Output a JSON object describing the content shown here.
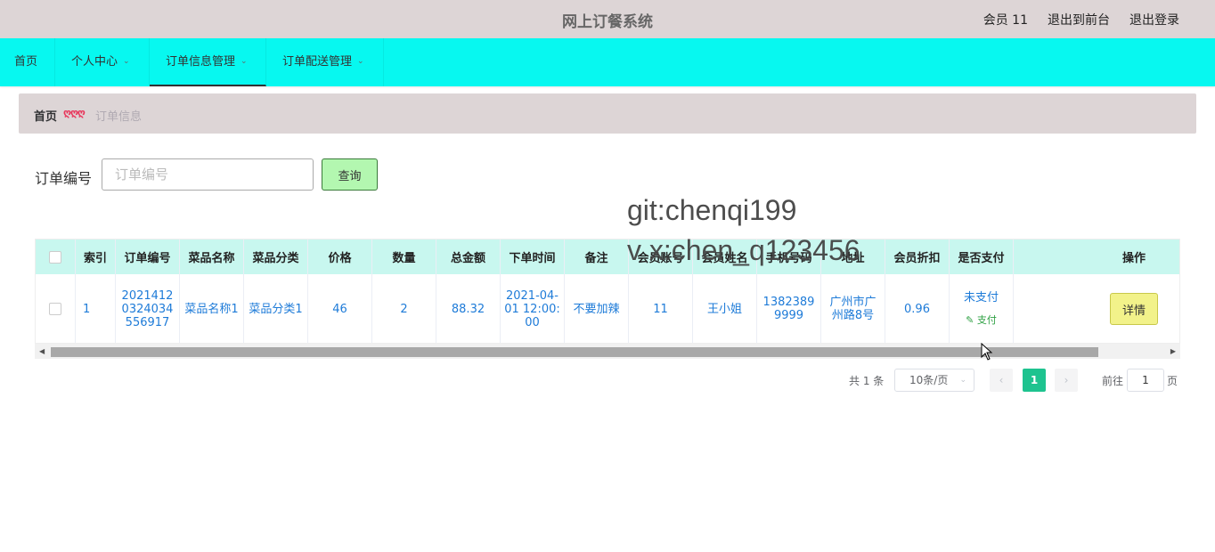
{
  "header": {
    "title": "网上订餐系统",
    "member": "会员 11",
    "exit_front": "退出到前台",
    "logout": "退出登录"
  },
  "nav": {
    "items": [
      {
        "label": "首页",
        "dropdown": false
      },
      {
        "label": "个人中心",
        "dropdown": true
      },
      {
        "label": "订单信息管理",
        "dropdown": true,
        "active": true
      },
      {
        "label": "订单配送管理",
        "dropdown": true
      }
    ],
    "chevron": "⌄"
  },
  "breadcrumb": {
    "home": "首页",
    "separator": "ღღღ",
    "current": "订单信息"
  },
  "search": {
    "label": "订单编号",
    "placeholder": "订单编号",
    "button": "查询"
  },
  "watermark": {
    "line1": "git:chenqi199",
    "line2": "v x:chen_q123456"
  },
  "table": {
    "headers": [
      "",
      "索引",
      "订单编号",
      "菜品名称",
      "菜品分类",
      "价格",
      "数量",
      "总金额",
      "下单时间",
      "备注",
      "会员账号",
      "会员姓名",
      "手机号码",
      "地址",
      "会员折扣",
      "是否支付",
      "",
      "操作"
    ],
    "rows": [
      {
        "index": "1",
        "order_no": "20214120324034556917",
        "dish_name": "菜品名称1",
        "dish_category": "菜品分类1",
        "price": "46",
        "quantity": "2",
        "total": "88.32",
        "order_time": "2021-04-01 12:00:00",
        "note": "不要加辣",
        "member_account": "11",
        "member_name": "王小姐",
        "phone": "13823899999",
        "address": "广州市广州路8号",
        "discount": "0.96",
        "paid_status": "未支付",
        "pay_action": "支付",
        "detail": "详情"
      }
    ]
  },
  "pagination": {
    "total": "共 1 条",
    "page_size": "10条/页",
    "current_page": "1",
    "goto_label": "前往",
    "goto_value": "1",
    "page_suffix": "页",
    "prev": "‹",
    "next": "›"
  },
  "colors": {
    "header_bg": "#ddd5d6",
    "nav_bg": "#07f8f0",
    "table_header_bg": "#c8f7ef",
    "link_blue": "#1e7bd8",
    "pager_active": "#1ec38f"
  }
}
